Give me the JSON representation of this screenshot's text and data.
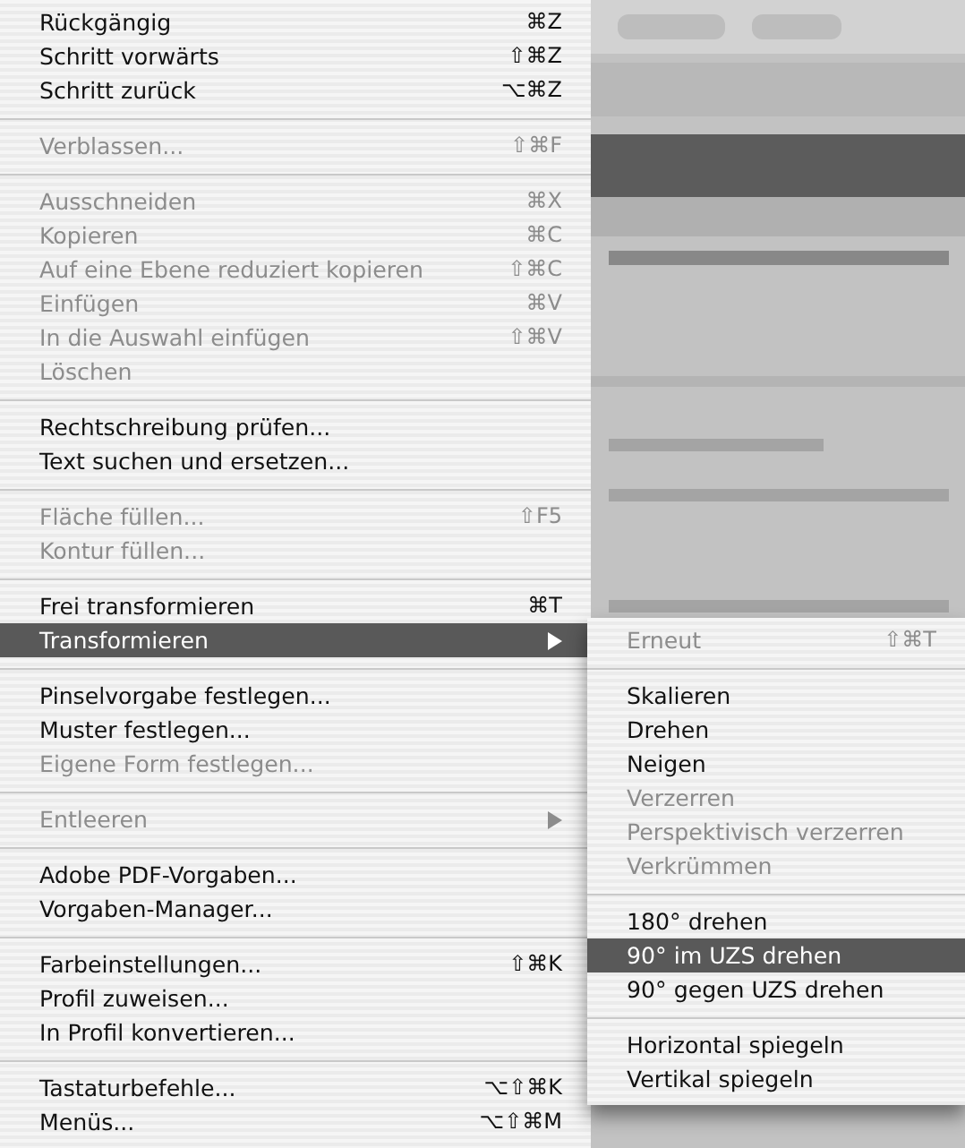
{
  "menu": {
    "items": [
      {
        "kind": "item",
        "label": "Rückgängig",
        "shortcut": "⌘Z",
        "disabled": false,
        "selected": false
      },
      {
        "kind": "item",
        "label": "Schritt vorwärts",
        "shortcut": "⇧⌘Z",
        "disabled": false,
        "selected": false
      },
      {
        "kind": "item",
        "label": "Schritt zurück",
        "shortcut": "⌥⌘Z",
        "disabled": false,
        "selected": false
      },
      {
        "kind": "separator"
      },
      {
        "kind": "item",
        "label": "Verblassen...",
        "shortcut": "⇧⌘F",
        "disabled": true,
        "selected": false
      },
      {
        "kind": "separator"
      },
      {
        "kind": "item",
        "label": "Ausschneiden",
        "shortcut": "⌘X",
        "disabled": true,
        "selected": false
      },
      {
        "kind": "item",
        "label": "Kopieren",
        "shortcut": "⌘C",
        "disabled": true,
        "selected": false
      },
      {
        "kind": "item",
        "label": "Auf eine Ebene reduziert kopieren",
        "shortcut": "⇧⌘C",
        "disabled": true,
        "selected": false
      },
      {
        "kind": "item",
        "label": "Einfügen",
        "shortcut": "⌘V",
        "disabled": true,
        "selected": false
      },
      {
        "kind": "item",
        "label": "In die Auswahl einfügen",
        "shortcut": "⇧⌘V",
        "disabled": true,
        "selected": false
      },
      {
        "kind": "item",
        "label": "Löschen",
        "disabled": true,
        "selected": false
      },
      {
        "kind": "separator"
      },
      {
        "kind": "item",
        "label": "Rechtschreibung prüfen...",
        "disabled": false,
        "selected": false
      },
      {
        "kind": "item",
        "label": "Text suchen und ersetzen...",
        "disabled": false,
        "selected": false
      },
      {
        "kind": "separator"
      },
      {
        "kind": "item",
        "label": "Fläche füllen...",
        "shortcut": "⇧F5",
        "disabled": true,
        "selected": false
      },
      {
        "kind": "item",
        "label": "Kontur füllen...",
        "disabled": true,
        "selected": false
      },
      {
        "kind": "separator"
      },
      {
        "kind": "item",
        "label": "Frei transformieren",
        "shortcut": "⌘T",
        "disabled": false,
        "selected": false
      },
      {
        "kind": "item",
        "label": "Transformieren",
        "disabled": false,
        "selected": true,
        "has_submenu": true
      },
      {
        "kind": "separator"
      },
      {
        "kind": "item",
        "label": "Pinselvorgabe festlegen...",
        "disabled": false,
        "selected": false
      },
      {
        "kind": "item",
        "label": "Muster festlegen...",
        "disabled": false,
        "selected": false
      },
      {
        "kind": "item",
        "label": "Eigene Form festlegen...",
        "disabled": true,
        "selected": false
      },
      {
        "kind": "separator"
      },
      {
        "kind": "item",
        "label": "Entleeren",
        "disabled": true,
        "selected": false,
        "has_submenu": true
      },
      {
        "kind": "separator"
      },
      {
        "kind": "item",
        "label": "Adobe PDF-Vorgaben...",
        "disabled": false,
        "selected": false
      },
      {
        "kind": "item",
        "label": "Vorgaben-Manager...",
        "disabled": false,
        "selected": false
      },
      {
        "kind": "separator"
      },
      {
        "kind": "item",
        "label": "Farbeinstellungen...",
        "shortcut": "⇧⌘K",
        "disabled": false,
        "selected": false
      },
      {
        "kind": "item",
        "label": "Profil zuweisen...",
        "disabled": false,
        "selected": false
      },
      {
        "kind": "item",
        "label": "In Profil konvertieren...",
        "disabled": false,
        "selected": false
      },
      {
        "kind": "separator"
      },
      {
        "kind": "item",
        "label": "Tastaturbefehle...",
        "shortcut": "⌥⇧⌘K",
        "disabled": false,
        "selected": false
      },
      {
        "kind": "item",
        "label": "Menüs...",
        "shortcut": "⌥⇧⌘M",
        "disabled": false,
        "selected": false
      }
    ]
  },
  "submenu": {
    "items": [
      {
        "kind": "item",
        "label": "Erneut",
        "shortcut": "⇧⌘T",
        "disabled": true,
        "selected": false
      },
      {
        "kind": "separator"
      },
      {
        "kind": "item",
        "label": "Skalieren",
        "disabled": false,
        "selected": false
      },
      {
        "kind": "item",
        "label": "Drehen",
        "disabled": false,
        "selected": false
      },
      {
        "kind": "item",
        "label": "Neigen",
        "disabled": false,
        "selected": false
      },
      {
        "kind": "item",
        "label": "Verzerren",
        "disabled": true,
        "selected": false
      },
      {
        "kind": "item",
        "label": "Perspektivisch verzerren",
        "disabled": true,
        "selected": false
      },
      {
        "kind": "item",
        "label": "Verkrümmen",
        "disabled": true,
        "selected": false
      },
      {
        "kind": "separator"
      },
      {
        "kind": "item",
        "label": "180° drehen",
        "disabled": false,
        "selected": false
      },
      {
        "kind": "item",
        "label": "90° im UZS drehen",
        "disabled": false,
        "selected": true
      },
      {
        "kind": "item",
        "label": "90° gegen UZS drehen",
        "disabled": false,
        "selected": false
      },
      {
        "kind": "separator"
      },
      {
        "kind": "item",
        "label": "Horizontal spiegeln",
        "disabled": false,
        "selected": false
      },
      {
        "kind": "item",
        "label": "Vertikal spiegeln",
        "disabled": false,
        "selected": false
      }
    ]
  }
}
